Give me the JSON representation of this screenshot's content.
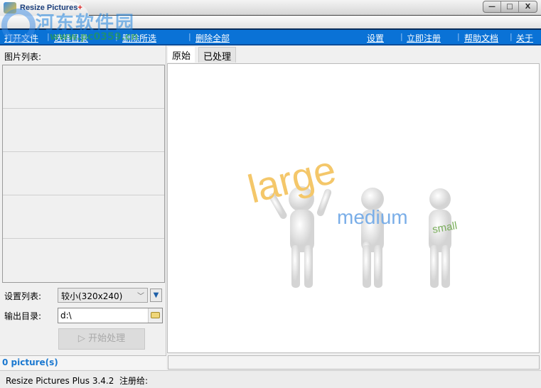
{
  "window": {
    "title": "Resize Pictures",
    "title_mark": "+",
    "minimize": "—",
    "maximize": "□",
    "close": "X"
  },
  "watermark": {
    "site": "河东软件园",
    "url": "www.pc0359.cn"
  },
  "menu": {
    "left": [
      "打开文件",
      "选择目录",
      "删除所选",
      "删除全部"
    ],
    "right": [
      "设置",
      "立即注册",
      "帮助文档",
      "关于"
    ]
  },
  "left": {
    "list_label": "图片列表:",
    "preset_label": "设置列表:",
    "preset_value": "较小(320x240)",
    "output_label": "输出目录:",
    "output_value": "d:\\",
    "start_button": "开始处理"
  },
  "tabs": [
    "原始",
    "已处理"
  ],
  "preview": {
    "words": [
      "large",
      "medium",
      "small"
    ]
  },
  "status": {
    "count": "0 picture(s)",
    "app_version": "Resize Pictures Plus 3.4.2",
    "registered_to": "注册给:"
  },
  "colors": {
    "menu_bar": "#0a72d6",
    "status_text": "#1a78d0"
  }
}
